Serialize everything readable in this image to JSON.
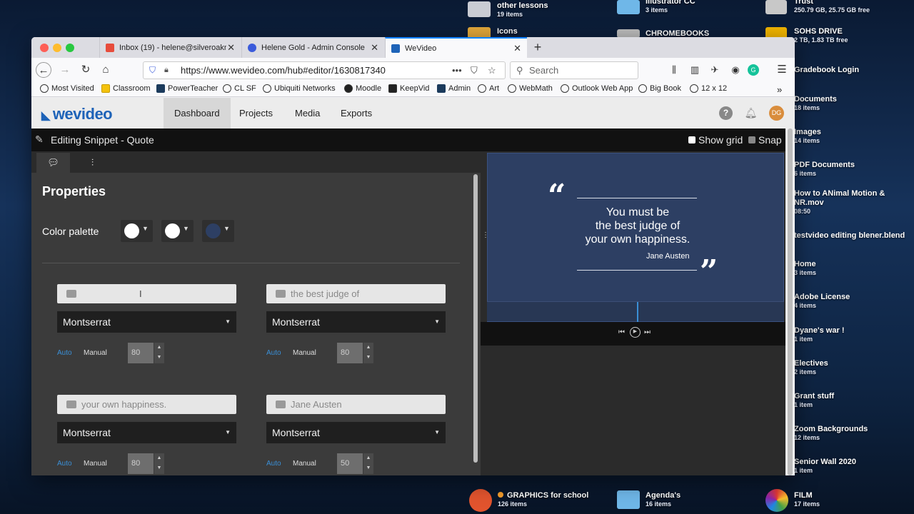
{
  "desktop": {
    "right_items": [
      {
        "name": "Trust",
        "sub": "250.79 GB, 25.75 GB free"
      },
      {
        "name": "SOHS DRIVE",
        "sub": "2 TB, 1.83 TB free"
      },
      {
        "name": "Gradebook Login",
        "sub": ""
      },
      {
        "name": "Documents",
        "sub": "18 items"
      },
      {
        "name": "Images",
        "sub": "14 items"
      },
      {
        "name": "PDF Documents",
        "sub": "6 items"
      },
      {
        "name": "How to ANimal Motion & NR.mov",
        "sub": "08:50"
      },
      {
        "name": "testvideo editing blener.blend",
        "sub": ""
      },
      {
        "name": "Home",
        "sub": "3 items"
      },
      {
        "name": "Adobe License",
        "sub": "4 items"
      },
      {
        "name": "Dyane's war !",
        "sub": "1 item"
      },
      {
        "name": "Electives",
        "sub": "2 items"
      },
      {
        "name": "Grant stuff",
        "sub": "1 item"
      },
      {
        "name": "Zoom Backgrounds",
        "sub": "12 items"
      },
      {
        "name": "Senior Wall 2020",
        "sub": "1 item"
      }
    ],
    "top_items": [
      {
        "name": "other lessons",
        "sub": "19 items"
      },
      {
        "name": "Icons",
        "sub": ""
      },
      {
        "name": "Illustrator CC",
        "sub": "3 items"
      },
      {
        "name": "CHROMEBOOKS",
        "sub": ""
      }
    ],
    "bottom_items": [
      {
        "name": "GRAPHICS for school",
        "sub": "126 items"
      },
      {
        "name": "Agenda's",
        "sub": "16 items"
      },
      {
        "name": "FILM",
        "sub": "17 items"
      }
    ]
  },
  "browser": {
    "tabs": [
      {
        "title": "Inbox (19) - helene@silveroakm",
        "icon": "gmail-icon"
      },
      {
        "title": "Helene Gold - Admin Console",
        "icon": "admin-icon"
      },
      {
        "title": "WeVideo",
        "icon": "wevideo-icon"
      }
    ],
    "url": "https://www.wevideo.com/hub#editor/1630817340",
    "search_placeholder": "Search",
    "bookmarks": [
      "Most Visited",
      "Classroom",
      "PowerTeacher",
      "CL SF",
      "Ubiquiti Networks",
      "Moodle",
      "KeepVid",
      "Admin",
      "Art",
      "WebMath",
      "Outlook Web App",
      "Big Book",
      "12 x 12"
    ]
  },
  "app": {
    "logo": "wevideo",
    "nav": [
      "Dashboard",
      "Projects",
      "Media",
      "Exports"
    ],
    "avatar": "DG",
    "editing_title": "Editing Snippet - Quote",
    "show_grid": "Show grid",
    "snap": "Snap",
    "properties_title": "Properties",
    "color_palette_label": "Color palette",
    "palette": [
      "#ffffff",
      "#ffffff",
      "#2d3f63"
    ],
    "text_blocks": [
      {
        "text": "",
        "font": "Montserrat",
        "auto": "Auto",
        "manual": "Manual",
        "size": "80"
      },
      {
        "text": "the best judge of",
        "font": "Montserrat",
        "auto": "Auto",
        "manual": "Manual",
        "size": "80"
      },
      {
        "text": "your own happiness.",
        "font": "Montserrat",
        "auto": "Auto",
        "manual": "Manual",
        "size": "80"
      },
      {
        "text": "Jane Austen",
        "font": "Montserrat",
        "auto": "Auto",
        "manual": "Manual",
        "size": "50"
      }
    ],
    "preview": {
      "line1": "You must be",
      "line2": "the best judge of",
      "line3": "your own happiness.",
      "author": "Jane Austen"
    }
  }
}
